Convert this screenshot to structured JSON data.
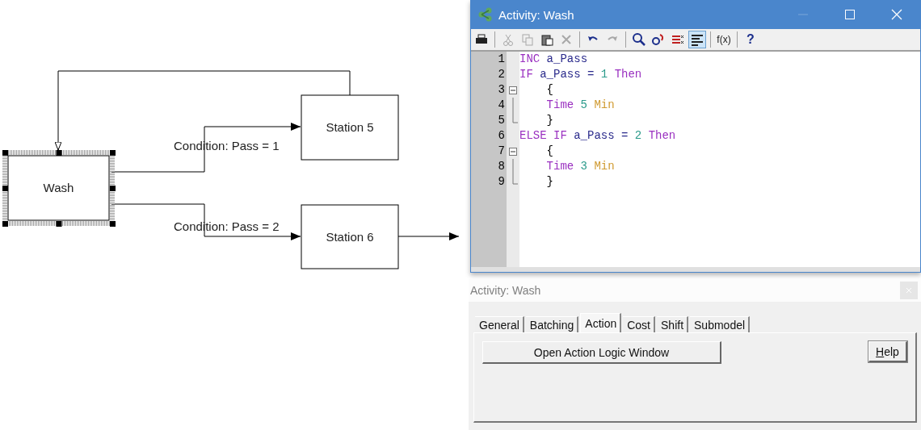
{
  "diagram": {
    "nodes": [
      {
        "label": "Wash",
        "selected": true
      },
      {
        "label": "Station 5",
        "selected": false
      },
      {
        "label": "Station 6",
        "selected": false
      }
    ],
    "connectors": [
      {
        "label": "Condition: Pass = 1"
      },
      {
        "label": "Condition: Pass = 2"
      }
    ]
  },
  "logic_window": {
    "title": "Activity: Wash",
    "toolbar": [
      {
        "kind": "print",
        "disabled": false,
        "selected": false
      },
      {
        "kind": "separator"
      },
      {
        "kind": "cut",
        "disabled": true,
        "selected": false
      },
      {
        "kind": "copy",
        "disabled": true,
        "selected": false
      },
      {
        "kind": "paste",
        "disabled": false,
        "selected": false
      },
      {
        "kind": "delete",
        "disabled": true,
        "selected": false
      },
      {
        "kind": "separator"
      },
      {
        "kind": "undo",
        "disabled": false,
        "selected": false
      },
      {
        "kind": "redo",
        "disabled": true,
        "selected": false
      },
      {
        "kind": "separator"
      },
      {
        "kind": "find",
        "disabled": false,
        "selected": false
      },
      {
        "kind": "replace",
        "disabled": false,
        "selected": false
      },
      {
        "kind": "bookmarks",
        "disabled": false,
        "selected": false
      },
      {
        "kind": "format",
        "disabled": false,
        "selected": true
      },
      {
        "kind": "separator"
      },
      {
        "kind": "text",
        "label": "f(x)",
        "disabled": false,
        "selected": false
      },
      {
        "kind": "separator"
      },
      {
        "kind": "text",
        "label": "?",
        "disabled": false,
        "selected": false
      }
    ],
    "lines": [
      {
        "number": "1",
        "tokens": [
          {
            "text": "INC",
            "kind": "keyword"
          },
          {
            "text": " a_Pass",
            "kind": "ident"
          }
        ]
      },
      {
        "number": "2",
        "tokens": [
          {
            "text": "IF",
            "kind": "keyword"
          },
          {
            "text": " a_Pass = ",
            "kind": "ident"
          },
          {
            "text": "1",
            "kind": "number"
          },
          {
            "text": " Then",
            "kind": "keyword"
          }
        ]
      },
      {
        "number": "3",
        "expanded": true,
        "tokens": [
          {
            "text": "    {",
            "kind": "plain"
          }
        ],
        "children": [
          {
            "number": "4",
            "tokens": [
              {
                "text": "    Time",
                "kind": "keyword"
              },
              {
                "text": " 5",
                "kind": "number"
              },
              {
                "text": " Min",
                "kind": "unit"
              }
            ]
          },
          {
            "number": "5",
            "tokens": [
              {
                "text": "    }",
                "kind": "plain"
              }
            ]
          }
        ]
      },
      {
        "number": "6",
        "tokens": [
          {
            "text": "ELSE IF",
            "kind": "keyword"
          },
          {
            "text": " a_Pass = ",
            "kind": "ident"
          },
          {
            "text": "2",
            "kind": "number"
          },
          {
            "text": " Then",
            "kind": "keyword"
          }
        ]
      },
      {
        "number": "7",
        "expanded": true,
        "tokens": [
          {
            "text": "    {",
            "kind": "plain"
          }
        ],
        "children": [
          {
            "number": "8",
            "tokens": [
              {
                "text": "    Time",
                "kind": "keyword"
              },
              {
                "text": " 3",
                "kind": "number"
              },
              {
                "text": " Min",
                "kind": "unit"
              }
            ]
          },
          {
            "number": "9",
            "tokens": [
              {
                "text": "    }",
                "kind": "plain"
              }
            ]
          }
        ]
      }
    ]
  },
  "dialog": {
    "title": "Activity: Wash",
    "tabs": [
      {
        "label": "General",
        "selected": false
      },
      {
        "label": "Batching",
        "selected": false
      },
      {
        "label": "Action",
        "selected": true
      },
      {
        "label": "Cost",
        "selected": false
      },
      {
        "label": "Shift",
        "selected": false
      },
      {
        "label": "Submodel",
        "selected": false
      }
    ],
    "buttons": [
      {
        "label": "Open Action Logic Window",
        "kind": "wide"
      },
      {
        "label": "Help",
        "kind": "small"
      }
    ]
  }
}
